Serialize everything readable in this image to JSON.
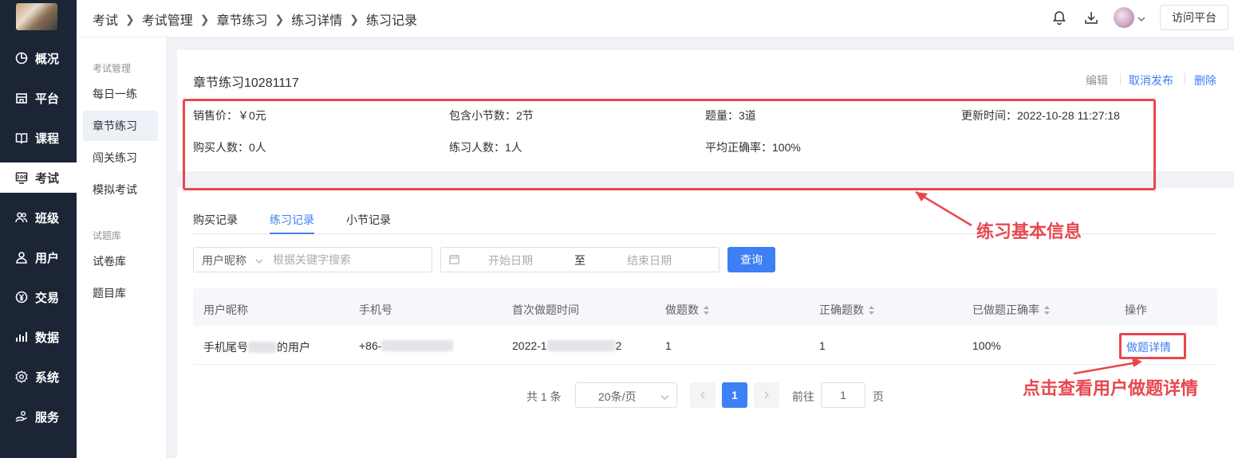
{
  "sidebar": {
    "items": [
      {
        "label": "概况",
        "icon": "pie-chart-icon"
      },
      {
        "label": "平台",
        "icon": "storefront-icon"
      },
      {
        "label": "课程",
        "icon": "book-icon"
      },
      {
        "label": "考试",
        "icon": "exam-100-icon",
        "active": true
      },
      {
        "label": "班级",
        "icon": "group-icon"
      },
      {
        "label": "用户",
        "icon": "user-icon"
      },
      {
        "label": "交易",
        "icon": "yen-circle-icon"
      },
      {
        "label": "数据",
        "icon": "bar-chart-icon"
      },
      {
        "label": "系统",
        "icon": "gear-icon"
      },
      {
        "label": "服务",
        "icon": "hand-service-icon"
      }
    ]
  },
  "subnav": {
    "group1": "考试管理",
    "items1": [
      "每日一练",
      "章节练习",
      "闯关练习",
      "模拟考试"
    ],
    "active": "章节练习",
    "group2": "试题库",
    "items2": [
      "试卷库",
      "题目库"
    ]
  },
  "breadcrumb": [
    "考试",
    "考试管理",
    "章节练习",
    "练习详情",
    "练习记录"
  ],
  "header": {
    "visit_label": "访问平台",
    "icons": [
      "bell-icon",
      "download-icon"
    ]
  },
  "practice": {
    "title": "章节练习10281117",
    "actions": {
      "edit": "编辑",
      "unpublish": "取消发布",
      "delete": "删除"
    },
    "info": {
      "price": "销售价：￥0元",
      "sections": "包含小节数：2节",
      "question_count": "题量：3道",
      "updated": "更新时间：2022-10-28 11:27:18",
      "buyers": "购买人数：0人",
      "practitioners": "练习人数：1人",
      "avg_accuracy": "平均正确率：100%"
    }
  },
  "tabs": [
    "购买记录",
    "练习记录",
    "小节记录"
  ],
  "active_tab": "练习记录",
  "filters": {
    "select_label": "用户昵称",
    "search_placeholder": "根据关键字搜索",
    "start_placeholder": "开始日期",
    "to_label": "至",
    "end_placeholder": "结束日期",
    "query_label": "查询"
  },
  "table": {
    "columns": [
      "用户昵称",
      "手机号",
      "首次做题时间",
      "做题数",
      "正确题数",
      "已做题正确率",
      "操作"
    ],
    "rows": [
      {
        "nickname_prefix": "手机尾号",
        "nickname_suffix": "的用户",
        "phone_prefix": "+86-",
        "first_time_prefix": "2022-1",
        "first_time_suffix": "2",
        "done": "1",
        "correct": "1",
        "accuracy": "100%",
        "action": "做题详情"
      }
    ]
  },
  "pagination": {
    "total": "共 1 条",
    "page_size": "20条/页",
    "current": "1",
    "goto_label": "前往",
    "goto_value": "1",
    "page_unit": "页"
  },
  "annotations": {
    "info_note": "练习基本信息",
    "detail_note": "点击查看用户做题详情",
    "color": "#e8474f"
  },
  "colors": {
    "primary": "#3d7ff5",
    "sidebar_bg": "#1b2536"
  }
}
